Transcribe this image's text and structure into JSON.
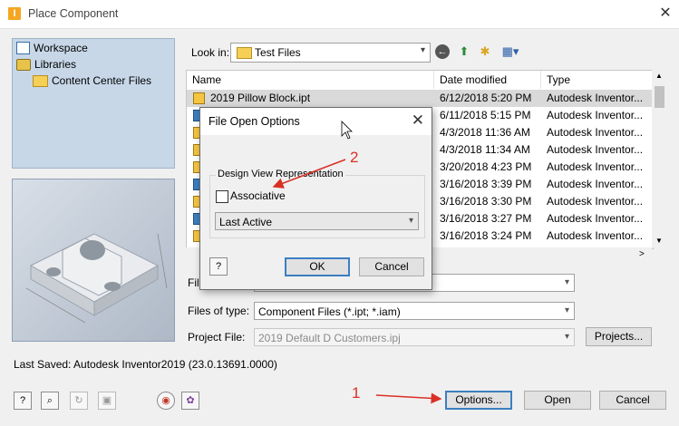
{
  "window": {
    "app_icon": "inventor-app-icon",
    "title": "Place Component",
    "close_glyph": "✕"
  },
  "places": [
    {
      "label": "Workspace",
      "icon": "workspace-icon"
    },
    {
      "label": "Libraries",
      "icon": "libraries-icon"
    },
    {
      "label": "Content Center Files",
      "icon": "folder-icon"
    }
  ],
  "look_in": {
    "label": "Look in:",
    "value": "Test Files"
  },
  "columns": {
    "name": "Name",
    "date": "Date modified",
    "type": "Type"
  },
  "files": [
    {
      "name": "2019 Pillow Block.ipt",
      "date": "6/12/2018 5:20 PM",
      "type": "Autodesk Inventor..."
    },
    {
      "name": "",
      "date": "6/11/2018 5:15 PM",
      "type": "Autodesk Inventor..."
    },
    {
      "name": "",
      "date": "4/3/2018 11:36 AM",
      "type": "Autodesk Inventor..."
    },
    {
      "name": "",
      "date": "4/3/2018 11:34 AM",
      "type": "Autodesk Inventor..."
    },
    {
      "name": "",
      "date": "3/20/2018 4:23 PM",
      "type": "Autodesk Inventor..."
    },
    {
      "name": "",
      "date": "3/16/2018 3:39 PM",
      "type": "Autodesk Inventor..."
    },
    {
      "name": "",
      "date": "3/16/2018 3:30 PM",
      "type": "Autodesk Inventor..."
    },
    {
      "name": "",
      "date": "3/16/2018 3:27 PM",
      "type": "Autodesk Inventor..."
    },
    {
      "name": "",
      "date": "3/16/2018 3:24 PM",
      "type": "Autodesk Inventor..."
    }
  ],
  "form": {
    "file_name_label": "File",
    "files_of_type_label": "Files of type:",
    "files_of_type_value": "Component Files (*.ipt; *.iam)",
    "project_file_label": "Project File:",
    "project_file_value": "2019 Default D Customers.ipj",
    "projects_button": "Projects..."
  },
  "status": "Last Saved: Autodesk Inventor2019 (23.0.13691.0000)",
  "buttons": {
    "options": "Options...",
    "open": "Open",
    "cancel": "Cancel"
  },
  "dialog": {
    "title": "File Open Options",
    "group_label": "Design View Representation",
    "associative_label": "Associative",
    "associative_checked": false,
    "representation_value": "Last Active",
    "ok": "OK",
    "cancel": "Cancel"
  },
  "annotations": {
    "step1": "1",
    "step2": "2",
    "color": "#d93025"
  }
}
